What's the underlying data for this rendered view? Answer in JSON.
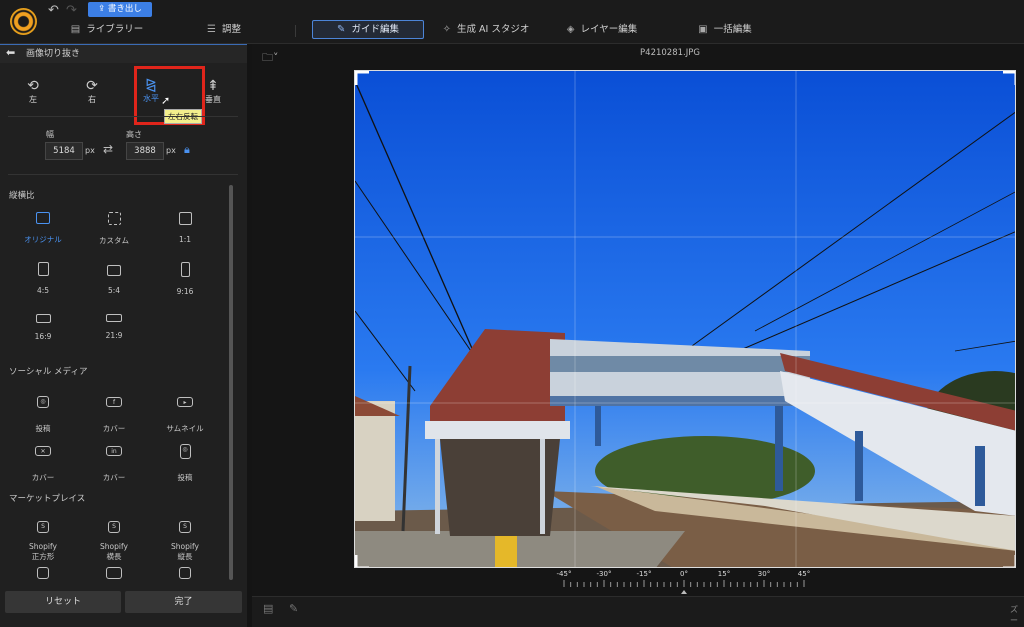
{
  "toolbar": {
    "export_label": "書き出し"
  },
  "tabs": [
    {
      "label": "ライブラリー"
    },
    {
      "label": "調整"
    },
    {
      "label": "ガイド編集"
    },
    {
      "label": "生成 AI スタジオ"
    },
    {
      "label": "レイヤー編集"
    },
    {
      "label": "一括編集"
    }
  ],
  "panel": {
    "title": "画像切り抜き",
    "rotate": [
      {
        "label": "左"
      },
      {
        "label": "右"
      },
      {
        "label": "水平"
      },
      {
        "label": "垂直"
      }
    ],
    "tooltip": "左右反転",
    "width_label": "幅",
    "height_label": "高さ",
    "width_value": "5184",
    "height_value": "3888",
    "unit": "px",
    "aspect_title": "縦横比",
    "ratios": [
      "オリジナル",
      "カスタム",
      "1:1",
      "4:5",
      "5:4",
      "9:16",
      "16:9",
      "21:9"
    ],
    "social_title": "ソーシャル メディア",
    "social": [
      "投稿",
      "カバー",
      "サムネイル",
      "カバー",
      "カバー",
      "投稿"
    ],
    "market_title": "マーケットプレイス",
    "market": [
      "Shopify\n正方形",
      "Shopify\n横長",
      "Shopify\n縦長"
    ],
    "reset": "リセット",
    "done": "完了"
  },
  "canvas": {
    "filename": "P4210281.JPG",
    "angles": [
      "-45°",
      "-30°",
      "-15°",
      "0°",
      "15°",
      "30°",
      "45°"
    ],
    "zoom_label": "ズー"
  },
  "colors": {
    "accent": "#3c7fe6",
    "highlight": "#e0251b"
  }
}
